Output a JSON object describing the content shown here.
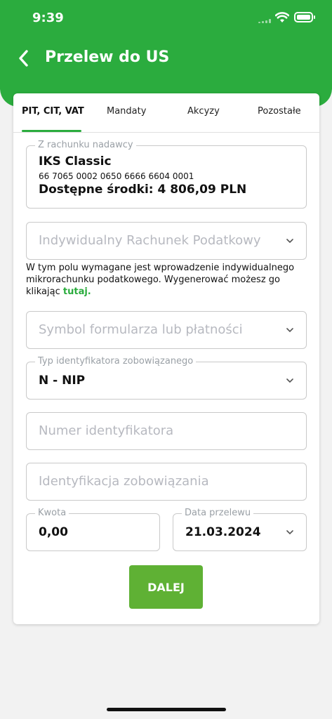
{
  "status_bar": {
    "time": "9:39"
  },
  "header": {
    "title": "Przelew do US"
  },
  "tabs": [
    {
      "label": "PIT, CIT, VAT",
      "active": true
    },
    {
      "label": "Mandaty",
      "active": false
    },
    {
      "label": "Akcyzy",
      "active": false
    },
    {
      "label": "Pozostałe",
      "active": false
    }
  ],
  "from_account": {
    "label": "Z rachunku nadawcy",
    "name": "IKS Classic",
    "number": "66 7065 0002 0650 6666 6604 0001",
    "balance": "Dostępne środki: 4 806,09 PLN"
  },
  "tax_account": {
    "placeholder": "Indywidualny Rachunek Podatkowy"
  },
  "info": {
    "text": "W tym polu wymagane jest wprowadzenie indywidualnego mikrorachunku podatkowego. Wygenerować możesz go klikając ",
    "link": "tutaj."
  },
  "form_symbol": {
    "placeholder": "Symbol formularza lub płatności"
  },
  "identifier_type": {
    "label": "Typ identyfikatora zobowiązanego",
    "value": "N - NIP"
  },
  "identifier_number": {
    "placeholder": "Numer identyfikatora"
  },
  "obligation_id": {
    "placeholder": "Identyfikacja zobowiązania"
  },
  "amount": {
    "label": "Kwota",
    "value": "0,00"
  },
  "transfer_date": {
    "label": "Data przelewu",
    "value": "21.03.2024"
  },
  "next_button": {
    "label": "DALEJ"
  },
  "colors": {
    "brand_green": "#2bac3e",
    "button_green": "#5fb134"
  }
}
